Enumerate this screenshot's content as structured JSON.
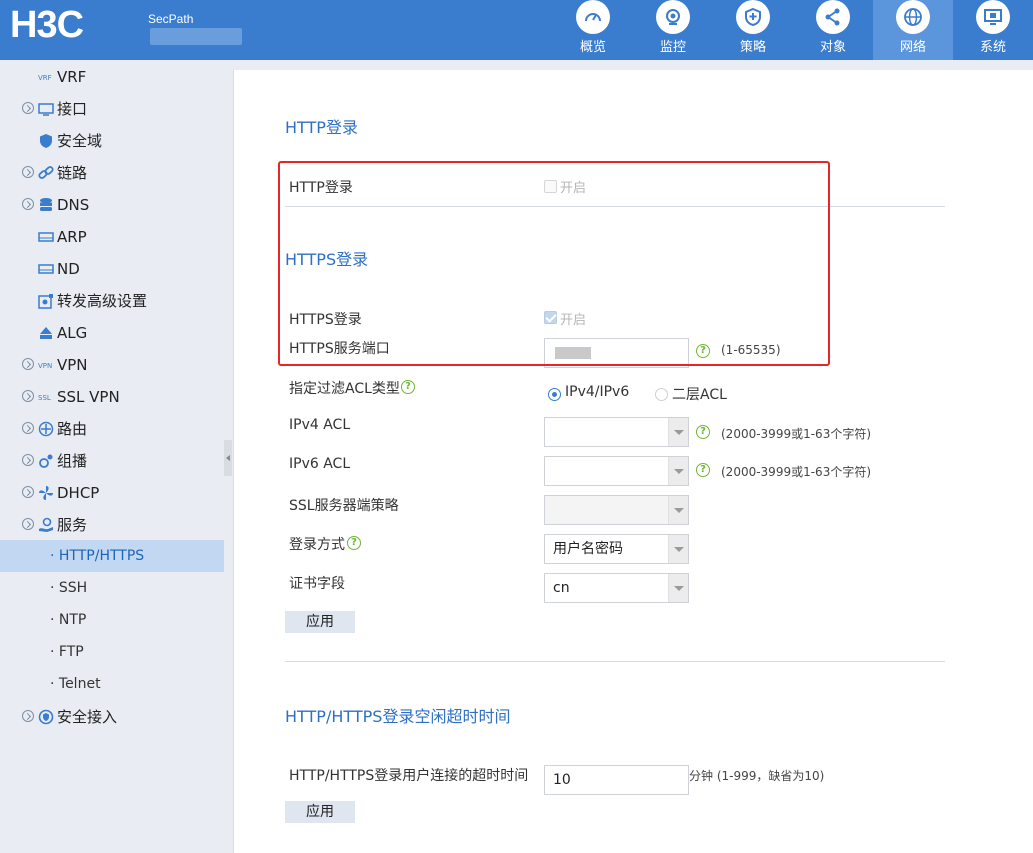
{
  "header": {
    "logo": "H3C",
    "product": "SecPath",
    "nav": [
      {
        "label": "概览",
        "icon": "gauge-icon"
      },
      {
        "label": "监控",
        "icon": "camera-icon"
      },
      {
        "label": "策略",
        "icon": "shield-icon"
      },
      {
        "label": "对象",
        "icon": "share-icon"
      },
      {
        "label": "网络",
        "icon": "globe-icon",
        "active": true
      },
      {
        "label": "系统",
        "icon": "monitor-icon"
      }
    ]
  },
  "sidebar": {
    "items": [
      {
        "label": "VRF"
      },
      {
        "label": "接口"
      },
      {
        "label": "安全域"
      },
      {
        "label": "链路"
      },
      {
        "label": "DNS"
      },
      {
        "label": "ARP"
      },
      {
        "label": "ND"
      },
      {
        "label": "转发高级设置"
      },
      {
        "label": "ALG"
      },
      {
        "label": "VPN"
      },
      {
        "label": "SSL VPN"
      },
      {
        "label": "路由"
      },
      {
        "label": "组播"
      },
      {
        "label": "DHCP"
      },
      {
        "label": "服务"
      }
    ],
    "sub": [
      {
        "label": "· HTTP/HTTPS"
      },
      {
        "label": "· SSH"
      },
      {
        "label": "· NTP"
      },
      {
        "label": "· FTP"
      },
      {
        "label": "· Telnet"
      }
    ],
    "last": "安全接入"
  },
  "http": {
    "section_title": "HTTP登录",
    "login_label": "HTTP登录",
    "enable_label": "开启"
  },
  "https": {
    "section_title": "HTTPS登录",
    "login_label": "HTTPS登录",
    "enable_label": "开启",
    "port_label": "HTTPS服务端口",
    "port_hint": "(1-65535)",
    "acl_type_label": "指定过滤ACL类型",
    "acl_opt1": "IPv4/IPv6",
    "acl_opt2": "二层ACL",
    "ipv4_acl_label": "IPv4 ACL",
    "ipv4_acl_hint": "(2000-3999或1-63个字符)",
    "ipv6_acl_label": "IPv6 ACL",
    "ipv6_acl_hint": "(2000-3999或1-63个字符)",
    "ssl_label": "SSL服务器端策略",
    "login_method_label": "登录方式",
    "login_method_value": "用户名密码",
    "cert_label": "证书字段",
    "cert_value": "cn",
    "apply": "应用"
  },
  "timeout": {
    "section_title": "HTTP/HTTPS登录空闲超时时间",
    "label": "HTTP/HTTPS登录用户连接的超时时间",
    "value": "10",
    "hint": "分钟 (1-999，缺省为10)",
    "apply": "应用"
  },
  "colors": {
    "header_bg": "#3a7ccd",
    "accent": "#2e70c4",
    "highlight": "#e8262a"
  }
}
